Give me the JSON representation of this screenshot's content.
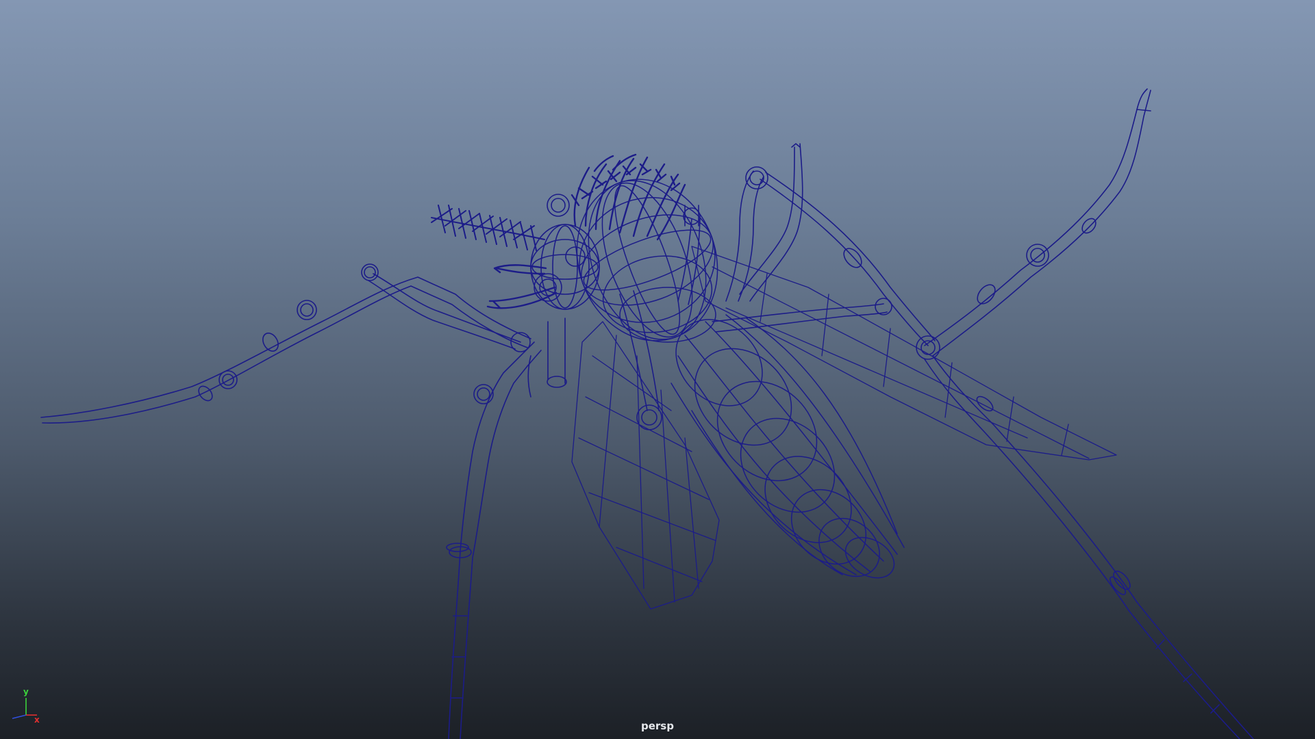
{
  "viewport": {
    "camera_label": "persp",
    "background_top": "#8497b3",
    "background_bottom": "#1c2026",
    "wire_color": "#1c1c88",
    "model_icon": "mosquito-wireframe-icon"
  },
  "axis_gizmo": {
    "y_label": "y",
    "x_label": "x",
    "y_color": "#3cd23c",
    "x_color": "#e03030",
    "z_color": "#3050e0"
  }
}
